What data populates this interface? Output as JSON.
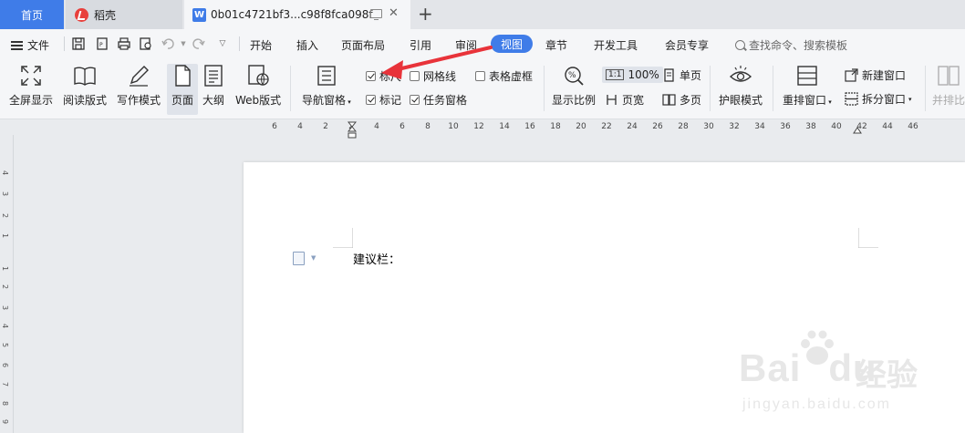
{
  "tabs": {
    "home": "首页",
    "daoke": "稻壳",
    "doc_title": "0b01c4721bf3...c98f8fca098f",
    "close": "✕",
    "add": "+"
  },
  "menu": {
    "file": "文件",
    "tabs": [
      "开始",
      "插入",
      "页面布局",
      "引用",
      "审阅",
      "视图",
      "章节",
      "开发工具",
      "会员专享"
    ],
    "active_tab": "视图",
    "search_placeholder": "查找命令、搜索模板"
  },
  "ribbon": {
    "fullscreen": "全屏显示",
    "reading": "阅读版式",
    "writing": "写作模式",
    "page": "页面",
    "outline": "大纲",
    "web": "Web版式",
    "nav_pane": "导航窗格",
    "checkboxes": [
      {
        "label": "标尺",
        "checked": true
      },
      {
        "label": "网格线",
        "checked": false
      },
      {
        "label": "表格虚框",
        "checked": false
      },
      {
        "label": "标记",
        "checked": true
      },
      {
        "label": "任务窗格",
        "checked": true
      }
    ],
    "zoom_ratio": "显示比例",
    "zoom_value": "100%",
    "zoom_tag": "1:1",
    "single_page": "单页",
    "page_width": "页宽",
    "multi_page": "多页",
    "eye_mode": "护眼模式",
    "rearrange": "重排窗口",
    "new_window": "新建窗口",
    "split_window": "拆分窗口",
    "side_by_side": "并排比"
  },
  "ruler": {
    "h_ticks": [
      "6",
      "4",
      "2",
      "2",
      "4",
      "6",
      "8",
      "10",
      "12",
      "14",
      "16",
      "18",
      "20",
      "22",
      "24",
      "26",
      "28",
      "30",
      "32",
      "34",
      "36",
      "38",
      "40",
      "42",
      "44",
      "46"
    ],
    "v_ticks": [
      "4",
      "3",
      "2",
      "1",
      "1",
      "2",
      "3",
      "4",
      "5",
      "6",
      "7",
      "8",
      "9"
    ]
  },
  "document": {
    "text": "建议栏："
  },
  "watermark": {
    "brand": "Bai",
    "brand2": "du",
    "jingyan": "经验",
    "url": "jingyan.baidu.com"
  },
  "colors": {
    "accent": "#3f7ce8",
    "arrow": "#e8333a"
  }
}
